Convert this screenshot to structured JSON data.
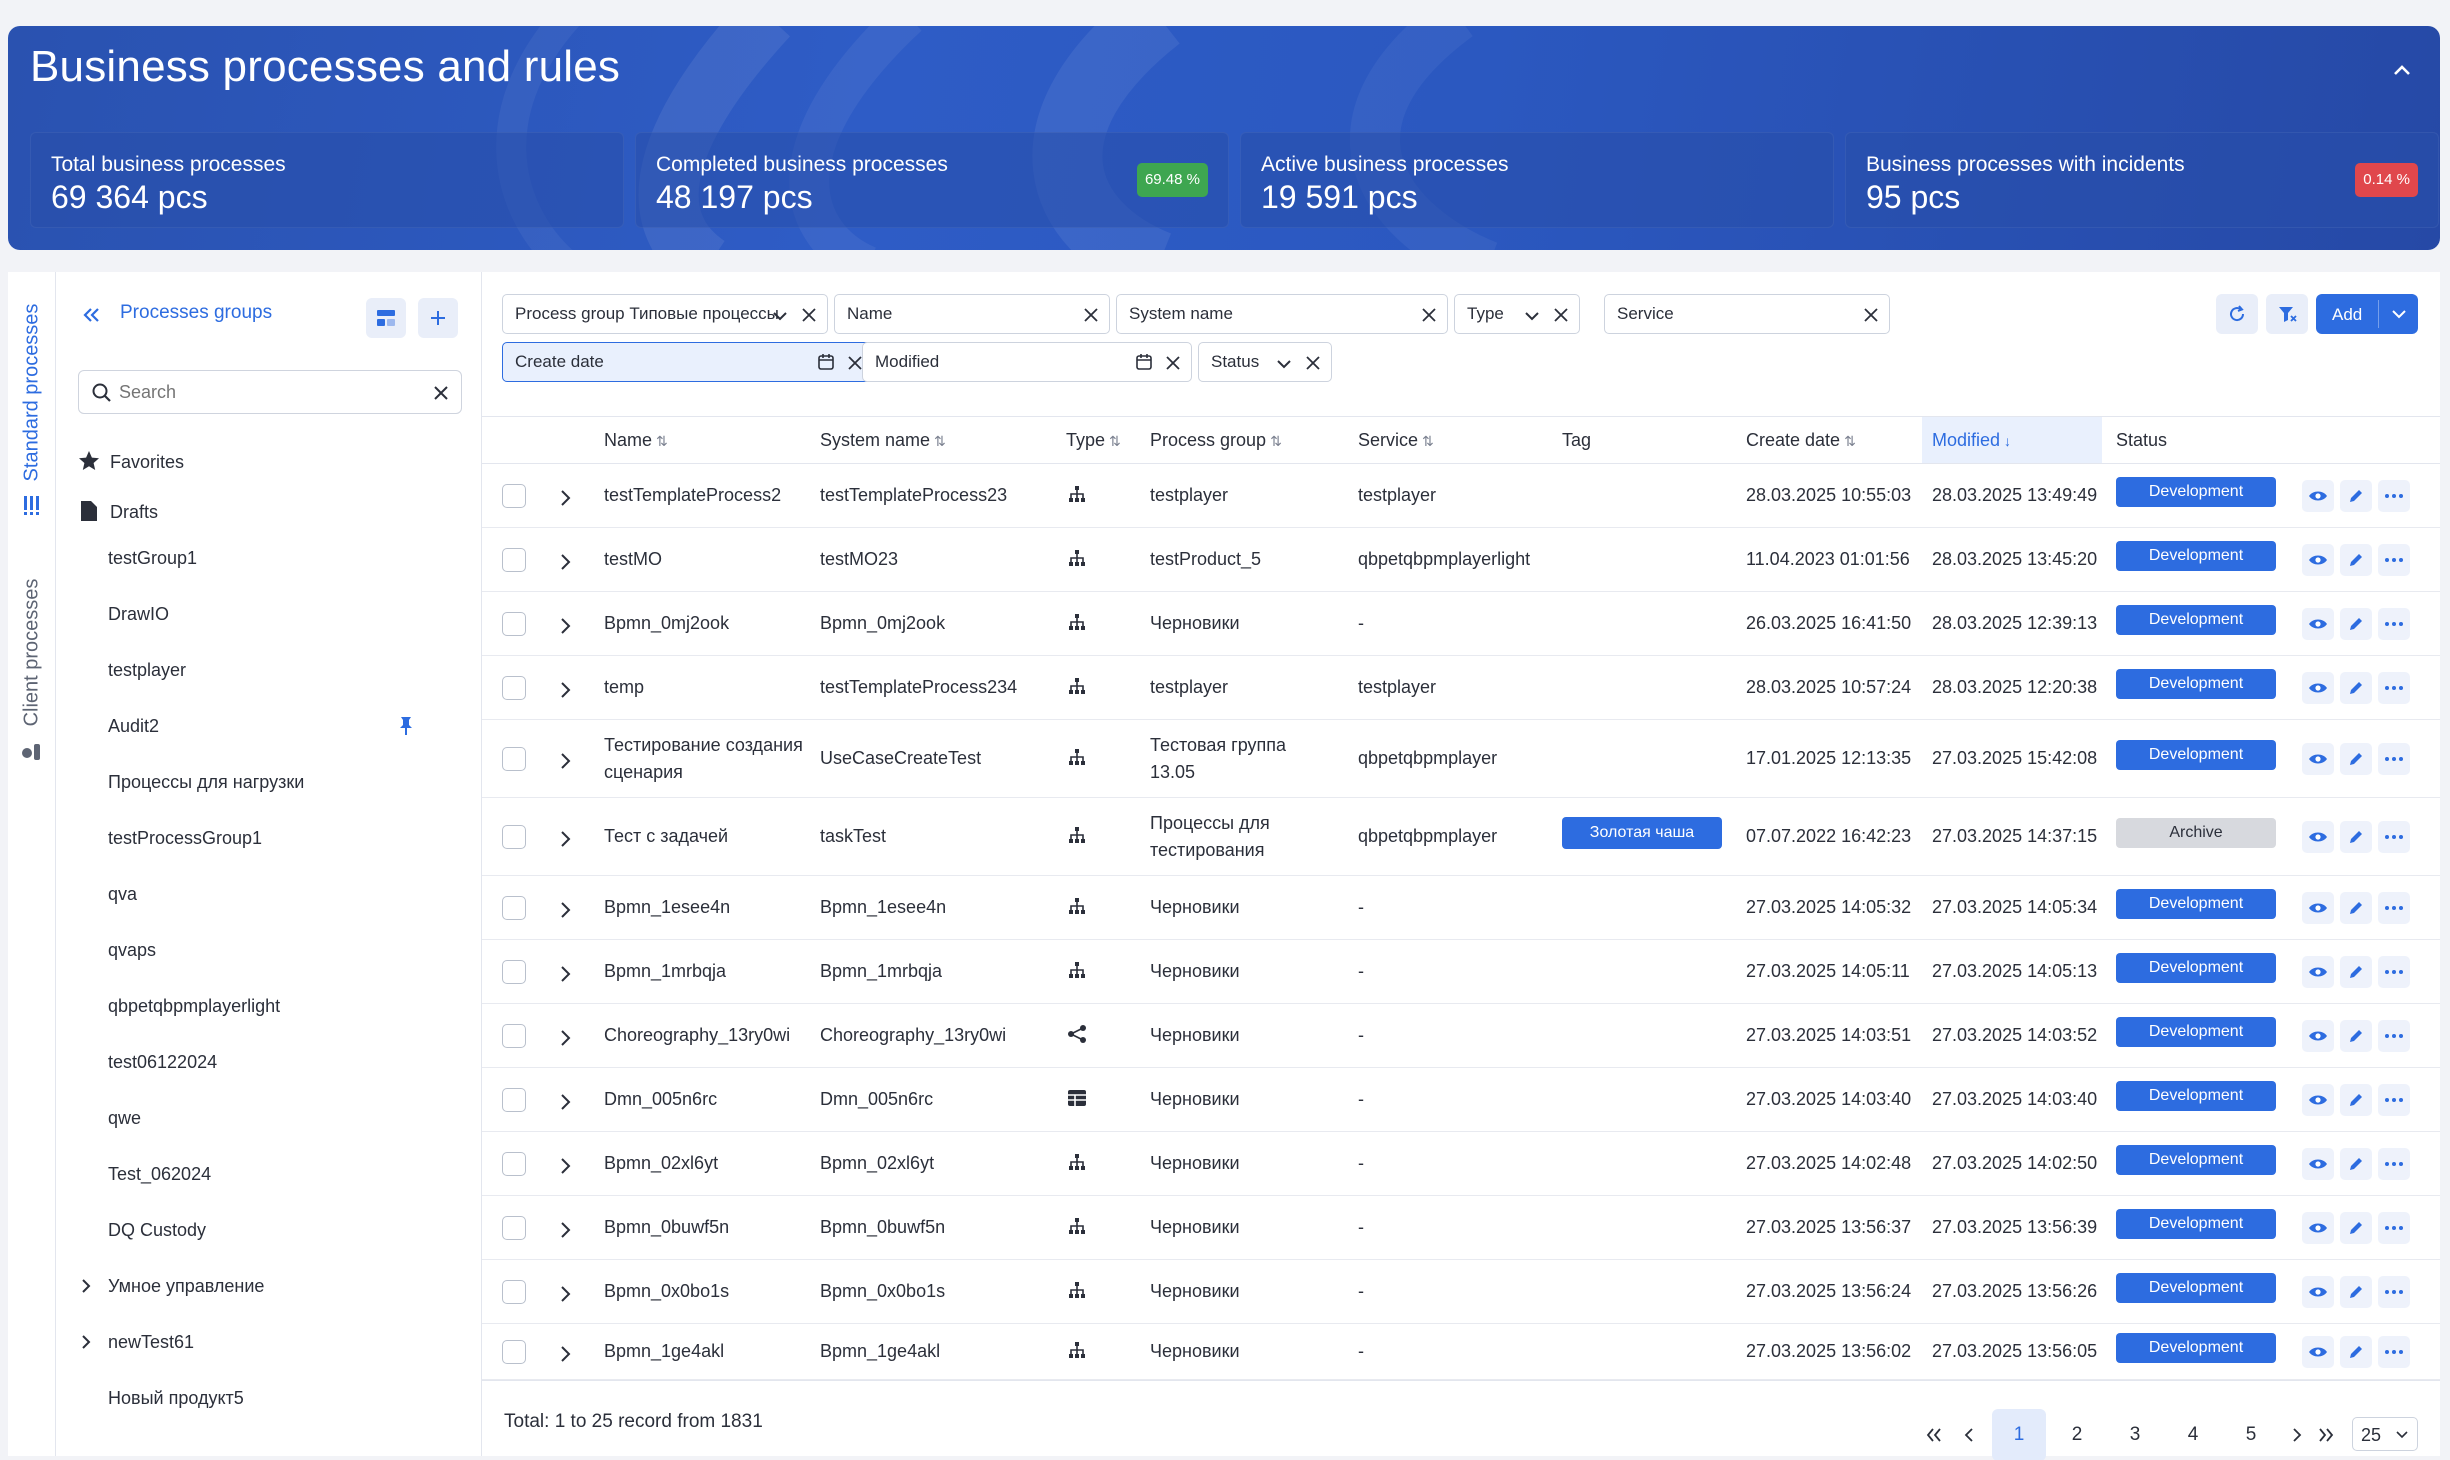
{
  "header": {
    "title": "Business processes and rules",
    "stats": [
      {
        "label": "Total business processes",
        "value": "69 364 pcs"
      },
      {
        "label": "Completed business processes",
        "value": "48 197 pcs",
        "percent": "69.48 %",
        "percent_color": "#3ea650"
      },
      {
        "label": "Active business processes",
        "value": "19 591 pcs"
      },
      {
        "label": "Business processes with incidents",
        "value": "95 pcs",
        "percent": "0.14 %",
        "percent_color": "#e0474c"
      }
    ]
  },
  "rail": {
    "tabs": [
      "Standard processes",
      "Client processes"
    ]
  },
  "groups": {
    "title": "Processes groups",
    "search_placeholder": "Search",
    "favorites": "Favorites",
    "drafts": "Drafts",
    "items": [
      "testGroup1",
      "DrawIO",
      "testplayer",
      "Audit2",
      "Процессы для нагрузки",
      "testProcessGroup1",
      "qva",
      "qvaps",
      "qbpetqbpmplayerlight",
      "test06122024",
      "qwe",
      "Test_062024",
      "DQ Custody",
      "Умное управление",
      "newTest61",
      "Новый продукт5"
    ]
  },
  "filters": {
    "process_group": "Process group Типовые процессы",
    "name": "Name",
    "system_name": "System name",
    "type": "Type",
    "service": "Service",
    "create_date": "Create date",
    "modified": "Modified",
    "status": "Status",
    "add_label": "Add"
  },
  "table": {
    "columns": {
      "name": "Name",
      "system_name": "System name",
      "type": "Type",
      "process_group": "Process group",
      "service": "Service",
      "tag": "Tag",
      "create_date": "Create date",
      "modified": "Modified",
      "status": "Status"
    },
    "rows": [
      {
        "name": "testTemplateProcess2",
        "system_name": "testTemplateProcess23",
        "type": "bpmn",
        "group": "testplayer",
        "service": "testplayer",
        "tag": "",
        "created": "28.03.2025 10:55:03",
        "modified": "28.03.2025 13:49:49",
        "status": "Development"
      },
      {
        "name": "testMO",
        "system_name": "testMO23",
        "type": "bpmn",
        "group": "testProduct_5",
        "service": "qbpetqbpmplayerlight",
        "tag": "",
        "created": "11.04.2023 01:01:56",
        "modified": "28.03.2025 13:45:20",
        "status": "Development"
      },
      {
        "name": "Bpmn_0mj2ook",
        "system_name": "Bpmn_0mj2ook",
        "type": "bpmn",
        "group": "Черновики",
        "service": "-",
        "tag": "",
        "created": "26.03.2025 16:41:50",
        "modified": "28.03.2025 12:39:13",
        "status": "Development"
      },
      {
        "name": "temp",
        "system_name": "testTemplateProcess234",
        "type": "bpmn",
        "group": "testplayer",
        "service": "testplayer",
        "tag": "",
        "created": "28.03.2025 10:57:24",
        "modified": "28.03.2025 12:20:38",
        "status": "Development"
      },
      {
        "name": "Тестирование создания сценария",
        "system_name": "UseCaseCreateTest",
        "type": "bpmn",
        "group": "Тестовая группа 13.05",
        "service": "qbpetqbpmplayer",
        "tag": "",
        "created": "17.01.2025 12:13:35",
        "modified": "27.03.2025 15:42:08",
        "status": "Development"
      },
      {
        "name": "Тест с задачей",
        "system_name": "taskTest",
        "type": "bpmn",
        "group": "Процессы для тестирования",
        "service": "qbpetqbpmplayer",
        "tag": "Золотая чаша",
        "created": "07.07.2022 16:42:23",
        "modified": "27.03.2025 14:37:15",
        "status": "Archive"
      },
      {
        "name": "Bpmn_1esee4n",
        "system_name": "Bpmn_1esee4n",
        "type": "bpmn",
        "group": "Черновики",
        "service": "-",
        "tag": "",
        "created": "27.03.2025 14:05:32",
        "modified": "27.03.2025 14:05:34",
        "status": "Development"
      },
      {
        "name": "Bpmn_1mrbqja",
        "system_name": "Bpmn_1mrbqja",
        "type": "bpmn",
        "group": "Черновики",
        "service": "-",
        "tag": "",
        "created": "27.03.2025 14:05:11",
        "modified": "27.03.2025 14:05:13",
        "status": "Development"
      },
      {
        "name": "Choreography_13ry0wi",
        "system_name": "Choreography_13ry0wi",
        "type": "choreography",
        "group": "Черновики",
        "service": "-",
        "tag": "",
        "created": "27.03.2025 14:03:51",
        "modified": "27.03.2025 14:03:52",
        "status": "Development"
      },
      {
        "name": "Dmn_005n6rc",
        "system_name": "Dmn_005n6rc",
        "type": "dmn",
        "group": "Черновики",
        "service": "-",
        "tag": "",
        "created": "27.03.2025 14:03:40",
        "modified": "27.03.2025 14:03:40",
        "status": "Development"
      },
      {
        "name": "Bpmn_02xl6yt",
        "system_name": "Bpmn_02xl6yt",
        "type": "bpmn",
        "group": "Черновики",
        "service": "-",
        "tag": "",
        "created": "27.03.2025 14:02:48",
        "modified": "27.03.2025 14:02:50",
        "status": "Development"
      },
      {
        "name": "Bpmn_0buwf5n",
        "system_name": "Bpmn_0buwf5n",
        "type": "bpmn",
        "group": "Черновики",
        "service": "-",
        "tag": "",
        "created": "27.03.2025 13:56:37",
        "modified": "27.03.2025 13:56:39",
        "status": "Development"
      },
      {
        "name": "Bpmn_0x0bo1s",
        "system_name": "Bpmn_0x0bo1s",
        "type": "bpmn",
        "group": "Черновики",
        "service": "-",
        "tag": "",
        "created": "27.03.2025 13:56:24",
        "modified": "27.03.2025 13:56:26",
        "status": "Development"
      },
      {
        "name": "Bpmn_1ge4akl",
        "system_name": "Bpmn_1ge4akl",
        "type": "bpmn",
        "group": "Черновики",
        "service": "-",
        "tag": "",
        "created": "27.03.2025 13:56:02",
        "modified": "27.03.2025 13:56:05",
        "status": "Development"
      }
    ]
  },
  "footer": {
    "total": "Total: 1 to 25 record from 1831",
    "pages": [
      "1",
      "2",
      "3",
      "4",
      "5"
    ],
    "current_page": "1",
    "page_size": "25"
  },
  "colors": {
    "accent": "#2d6ce0",
    "banner": "#2b58c0",
    "archive": "#d7d9de"
  }
}
